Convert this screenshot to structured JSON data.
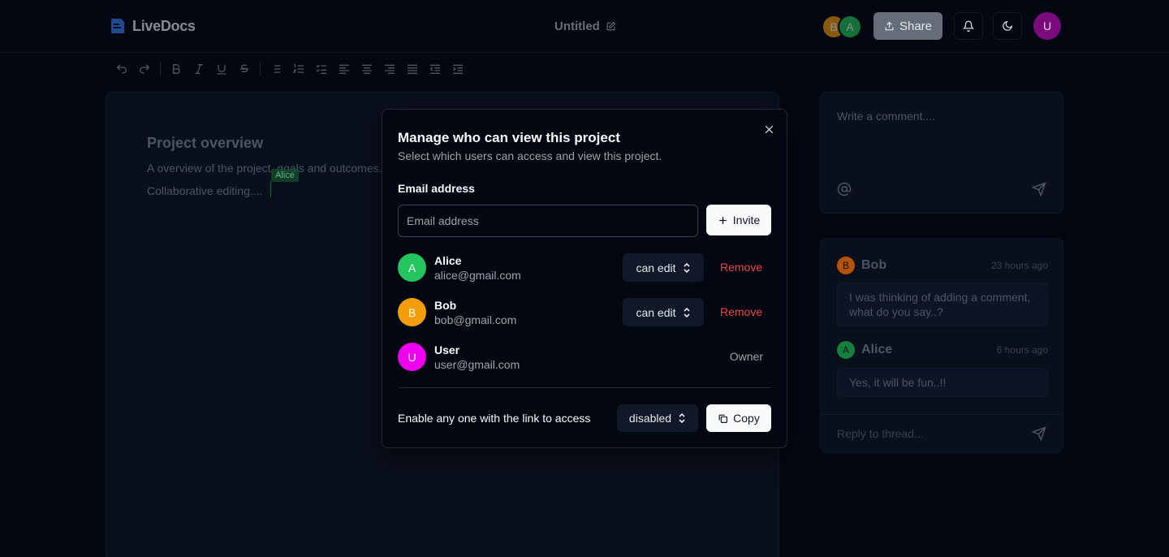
{
  "header": {
    "app_name": "LiveDocs",
    "doc_title": "Untitled",
    "collaborators": [
      {
        "initial": "B",
        "color": "#f59e0b"
      },
      {
        "initial": "A",
        "color": "#22c55e"
      }
    ],
    "share_label": "Share",
    "user_initial": "U"
  },
  "editor": {
    "heading": "Project overview",
    "paragraph": "A overview of the project, goals and outcomes.",
    "line2": "Collaborative editing....",
    "cursor_label": "Alice"
  },
  "comments": {
    "placeholder": "Write a comment....",
    "thread": [
      {
        "initial": "B",
        "name": "Bob",
        "time": "23 hours ago",
        "body": "I was thinking of adding a comment, what do you say..?",
        "color": "#b45309"
      },
      {
        "initial": "A",
        "name": "Alice",
        "time": "6 hours ago",
        "body": "Yes, it will be fun..!!",
        "color": "#15803d"
      }
    ],
    "reply_placeholder": "Reply to thread..."
  },
  "modal": {
    "title": "Manage who can view this project",
    "description": "Select which users can access and view this project.",
    "email_label": "Email address",
    "email_placeholder": "Email address",
    "invite_label": "Invite",
    "members": [
      {
        "initial": "A",
        "name": "Alice",
        "email": "alice@gmail.com",
        "permission": "can edit",
        "action": "Remove",
        "color": "#22c55e"
      },
      {
        "initial": "B",
        "name": "Bob",
        "email": "bob@gmail.com",
        "permission": "can edit",
        "action": "Remove",
        "color": "#f59e0b"
      },
      {
        "initial": "U",
        "name": "User",
        "email": "user@gmail.com",
        "role": "Owner",
        "color": "#ee00ee"
      }
    ],
    "link_text": "Enable any one with the link to access",
    "link_access": "disabled",
    "copy_label": "Copy"
  }
}
